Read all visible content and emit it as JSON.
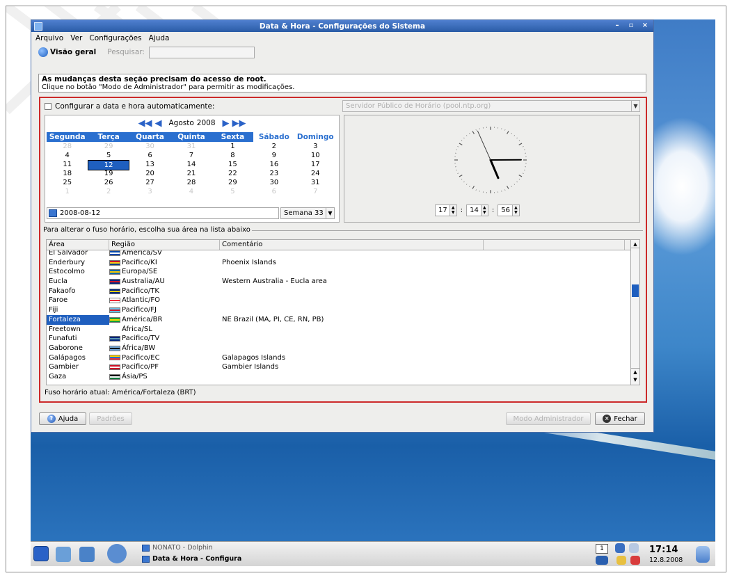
{
  "window": {
    "title": "Data & Hora - Configurações do Sistema",
    "controls": [
      "–",
      "▫",
      "×"
    ]
  },
  "menubar": [
    "Arquivo",
    "Ver",
    "Configurações",
    "Ajuda"
  ],
  "toolbar": {
    "overview_label": "Visão geral",
    "search_label": "Pesquisar:",
    "search_value": ""
  },
  "notice": {
    "title": "As mudanças desta seção precisam do acesso de root.",
    "body": "Clique no botão \"Modo de Administrador\" para permitir as modificações."
  },
  "auto_time": {
    "label": "Configurar a data e hora automaticamente:",
    "checked": false,
    "ntp_server": "Servidor Público de Horário (pool.ntp.org)"
  },
  "calendar": {
    "month": "Agosto",
    "year": "2008",
    "weekdays": [
      "Segunda",
      "Terça",
      "Quarta",
      "Quinta",
      "Sexta",
      "Sábado",
      "Domingo"
    ],
    "weeks": [
      [
        "28",
        "29",
        "30",
        "31",
        "1",
        "2",
        "3"
      ],
      [
        "4",
        "5",
        "6",
        "7",
        "8",
        "9",
        "10"
      ],
      [
        "11",
        "12",
        "13",
        "14",
        "15",
        "16",
        "17"
      ],
      [
        "18",
        "19",
        "20",
        "21",
        "22",
        "23",
        "24"
      ],
      [
        "25",
        "26",
        "27",
        "28",
        "29",
        "30",
        "31"
      ],
      [
        "1",
        "2",
        "3",
        "4",
        "5",
        "6",
        "7"
      ]
    ],
    "selected_day": "12",
    "date_value": "2008-08-12",
    "week_label": "Semana 33"
  },
  "clock": {
    "hour": "17",
    "minute": "14",
    "second": "56",
    "separator": ":"
  },
  "timezone": {
    "group_label": "Para alterar o fuso horário, escolha sua área na lista abaixo",
    "columns": [
      "Área",
      "Região",
      "Comentário",
      ""
    ],
    "rows": [
      {
        "area": "El Salvador",
        "region": "América/SV",
        "comment": "",
        "flag": [
          "#0047ab",
          "#ffffff",
          "#0047ab"
        ]
      },
      {
        "area": "Enderbury",
        "region": "Pacifico/KI",
        "comment": "Phoenix Islands",
        "flag": [
          "#ce1126",
          "#fcd116",
          "#003f87"
        ]
      },
      {
        "area": "Estocolmo",
        "region": "Europa/SE",
        "comment": "",
        "flag": [
          "#006aa7",
          "#fecc00",
          "#006aa7"
        ]
      },
      {
        "area": "Eucla",
        "region": "Australia/AU",
        "comment": "Western Australia - Eucla area",
        "flag": [
          "#00247d",
          "#cf142b",
          "#00247d"
        ]
      },
      {
        "area": "Fakaofo",
        "region": "Pacifico/TK",
        "comment": "",
        "flag": [
          "#00247d",
          "#ffce00",
          "#00247d"
        ]
      },
      {
        "area": "Faroe",
        "region": "Atlantic/FO",
        "comment": "",
        "flag": [
          "#ffffff",
          "#ed2939",
          "#ffffff"
        ]
      },
      {
        "area": "Fiji",
        "region": "Pacifico/FJ",
        "comment": "",
        "flag": [
          "#68bfe5",
          "#cf142b",
          "#68bfe5"
        ]
      },
      {
        "area": "Fortaleza",
        "region": "América/BR",
        "comment": "NE Brazil (MA, PI, CE, RN, PB)",
        "flag": [
          "#009c3b",
          "#ffdf00",
          "#009c3b"
        ],
        "selected": true
      },
      {
        "area": "Freetown",
        "region": "África/SL",
        "comment": "",
        "flag": []
      },
      {
        "area": "Funafuti",
        "region": "Pacifico/TV",
        "comment": "",
        "flag": [
          "#00247d",
          "#5b97b1",
          "#00247d"
        ]
      },
      {
        "area": "Gaborone",
        "region": "África/BW",
        "comment": "",
        "flag": [
          "#75aadb",
          "#000000",
          "#75aadb"
        ]
      },
      {
        "area": "Galápagos",
        "region": "Pacifico/EC",
        "comment": "Galapagos Islands",
        "flag": [
          "#ffd100",
          "#0072ce",
          "#ef3340"
        ]
      },
      {
        "area": "Gambier",
        "region": "Pacifico/PF",
        "comment": "Gambier Islands",
        "flag": [
          "#ce1126",
          "#ffffff",
          "#ce1126"
        ]
      },
      {
        "area": "Gaza",
        "region": "Ásia/PS",
        "comment": "",
        "flag": [
          "#000000",
          "#ffffff",
          "#007a3d"
        ]
      }
    ],
    "current": "Fuso horário atual: América/Fortaleza (BRT)"
  },
  "buttons": {
    "help": "Ajuda",
    "defaults": "Padrões",
    "admin": "Modo Administrador",
    "close": "Fechar"
  },
  "taskbar": {
    "task1": "NONATO - Dolphin",
    "task2": "Data & Hora - Configura",
    "pager": "1",
    "time": "17:14",
    "date": "12.8.2008"
  }
}
